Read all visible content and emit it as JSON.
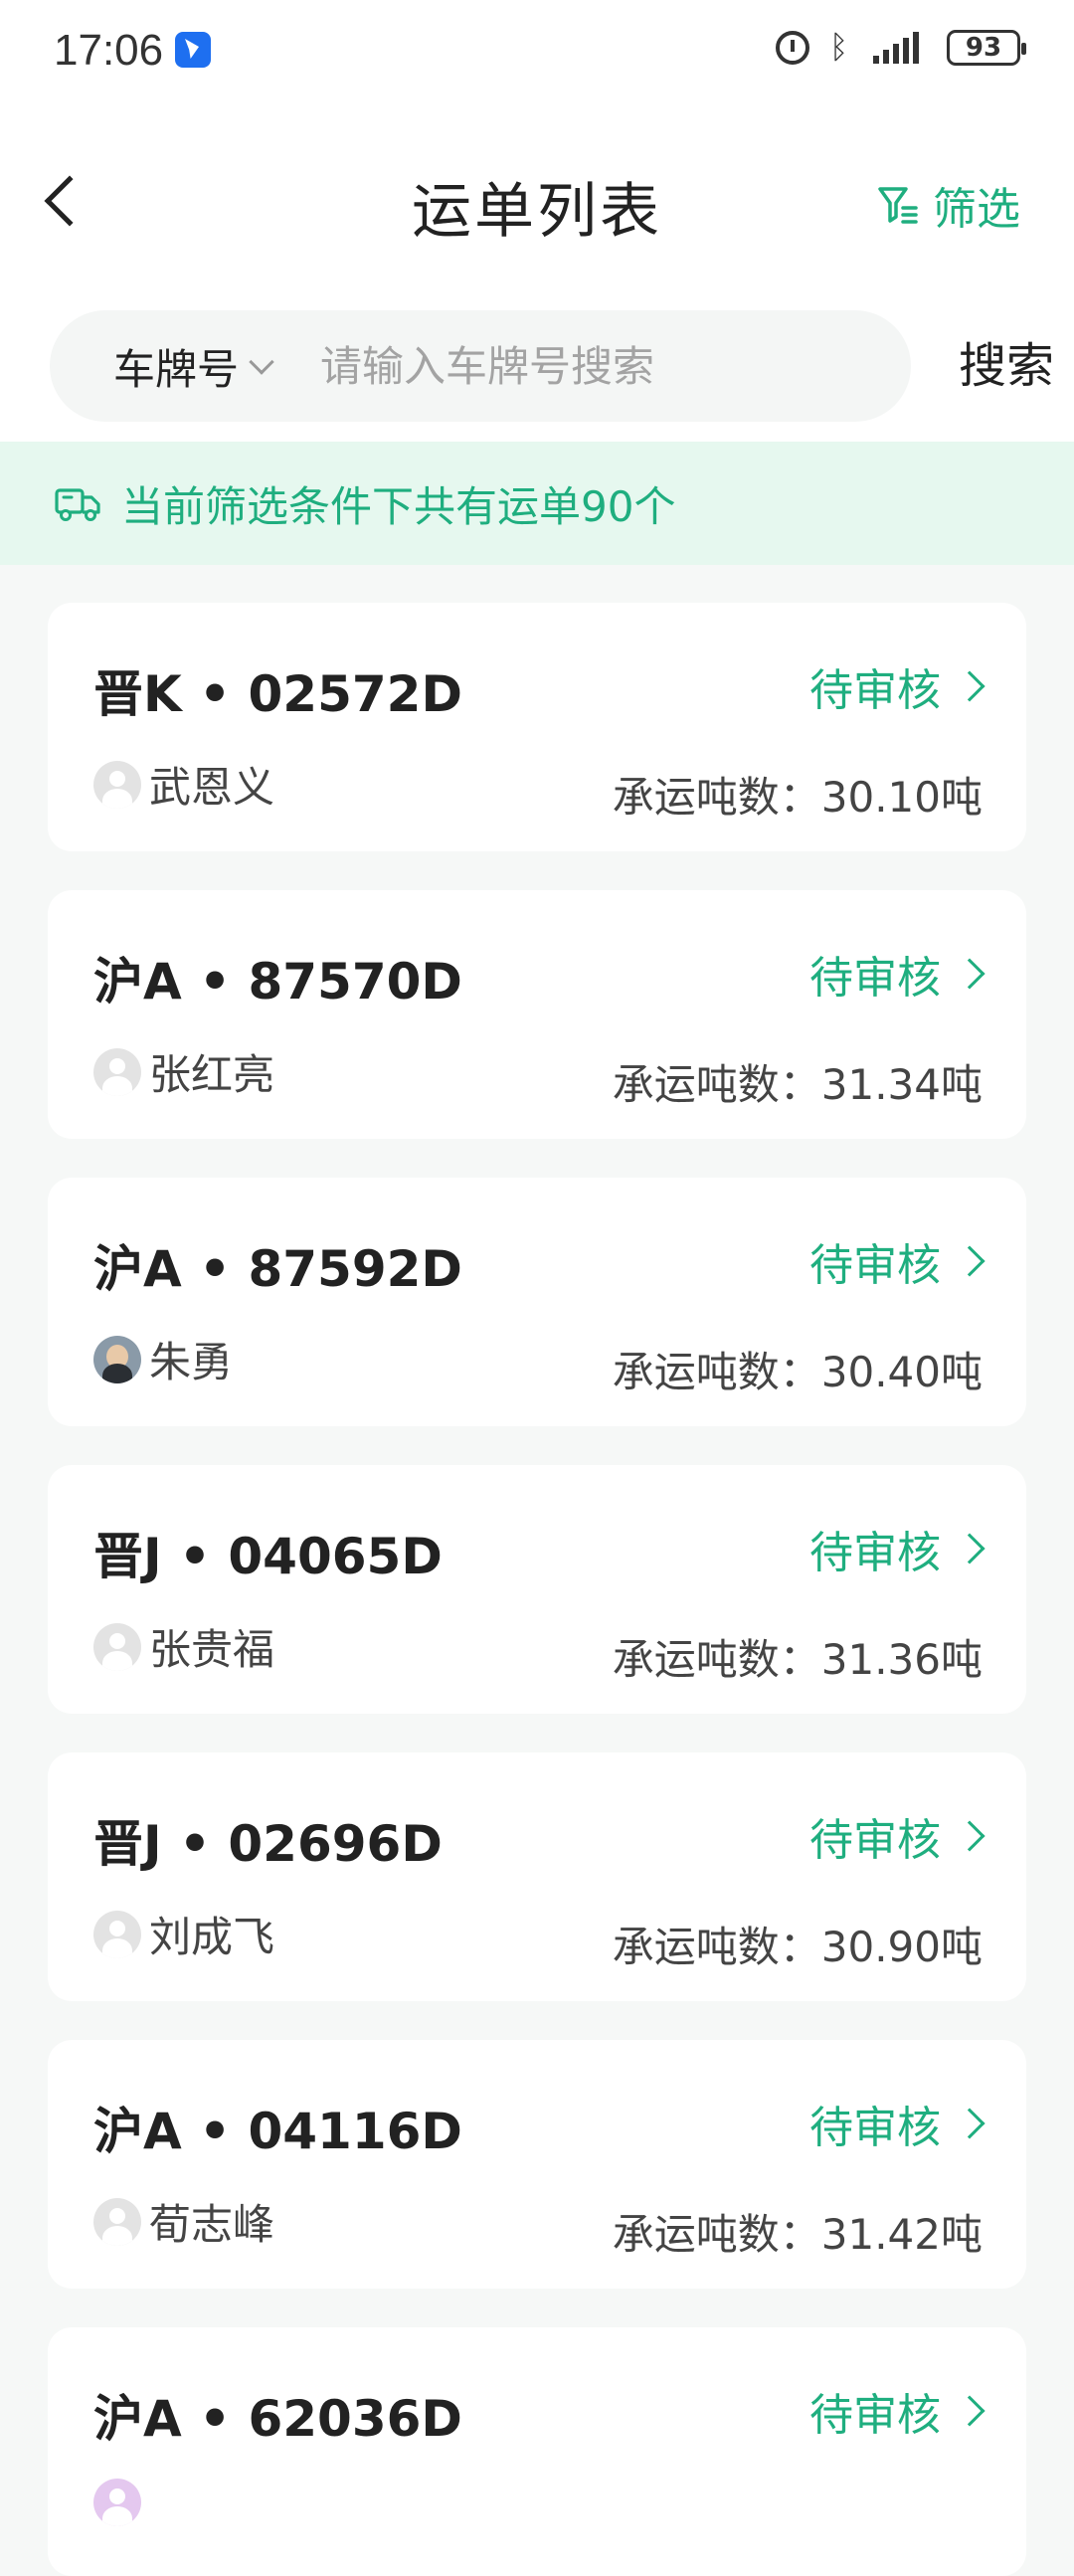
{
  "status_bar": {
    "time": "17:06",
    "battery": "93"
  },
  "header": {
    "title": "运单列表",
    "filter_label": "筛选"
  },
  "search": {
    "type_label": "车牌号",
    "placeholder": "请输入车牌号搜索",
    "button_label": "搜索"
  },
  "summary": {
    "text": "当前筛选条件下共有运单90个"
  },
  "colors": {
    "accent": "#1fae7f",
    "summary_bg": "#e6f8ef"
  },
  "orders": [
    {
      "plate": "晋K • 02572D",
      "status": "待审核",
      "driver": "武恩义",
      "avatar": "placeholder",
      "weight_label": "承运吨数：",
      "weight": "30.10吨"
    },
    {
      "plate": "沪A • 87570D",
      "status": "待审核",
      "driver": "张红亮",
      "avatar": "placeholder",
      "weight_label": "承运吨数：",
      "weight": "31.34吨"
    },
    {
      "plate": "沪A • 87592D",
      "status": "待审核",
      "driver": "朱勇",
      "avatar": "photo",
      "weight_label": "承运吨数：",
      "weight": "30.40吨"
    },
    {
      "plate": "晋J • 04065D",
      "status": "待审核",
      "driver": "张贵福",
      "avatar": "placeholder",
      "weight_label": "承运吨数：",
      "weight": "31.36吨"
    },
    {
      "plate": "晋J • 02696D",
      "status": "待审核",
      "driver": "刘成飞",
      "avatar": "placeholder",
      "weight_label": "承运吨数：",
      "weight": "30.90吨"
    },
    {
      "plate": "沪A • 04116D",
      "status": "待审核",
      "driver": "荀志峰",
      "avatar": "placeholder",
      "weight_label": "承运吨数：",
      "weight": "31.42吨"
    },
    {
      "plate": "沪A • 62036D",
      "status": "待审核",
      "driver": "",
      "avatar": "purple",
      "weight_label": "",
      "weight": ""
    }
  ]
}
